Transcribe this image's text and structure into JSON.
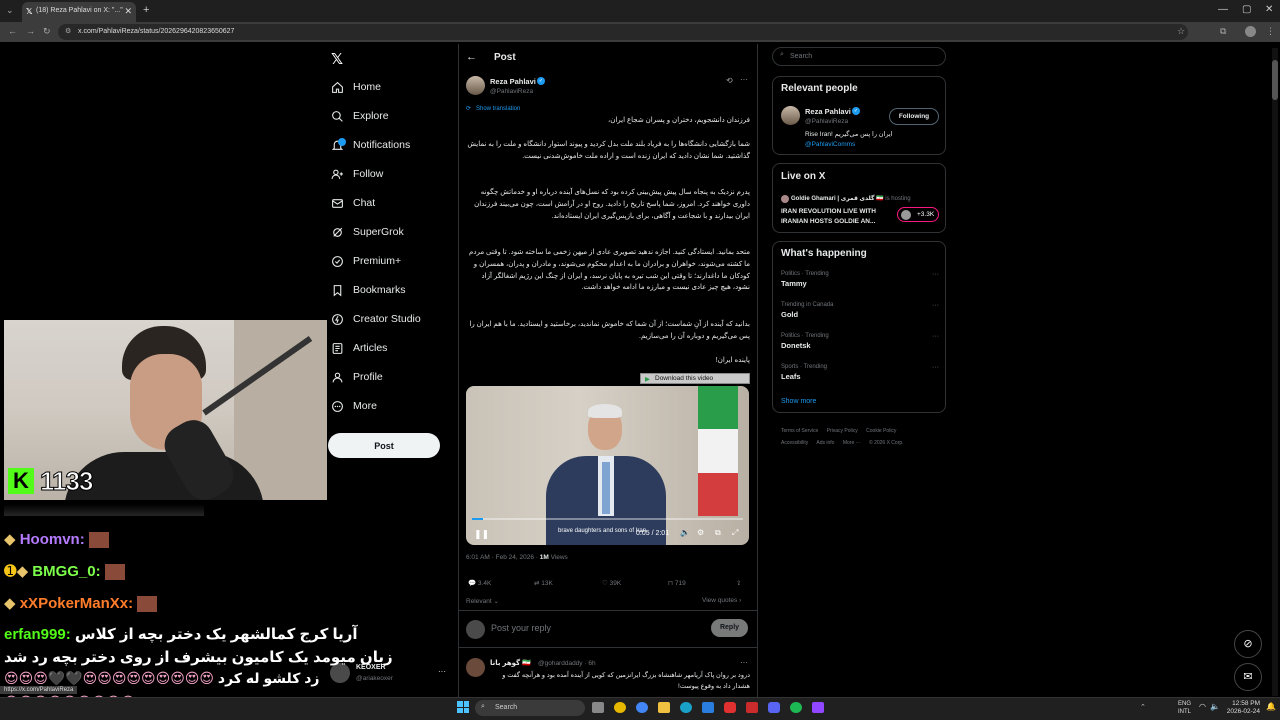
{
  "browser": {
    "tab_title": "(18) Reza Pahlavi on X: \"...\"",
    "url": "x.com/PahlaviReza/status/2026296420823650627",
    "status_url": "https://x.com/PahlaviReza"
  },
  "nav": {
    "items": [
      "Home",
      "Explore",
      "Notifications",
      "Follow",
      "Chat",
      "SuperGrok",
      "Premium+",
      "Bookmarks",
      "Creator Studio",
      "Articles",
      "Profile",
      "More"
    ],
    "post_button": "Post",
    "account_name": "KEOXER",
    "account_handle": "@ariakeoxer"
  },
  "post": {
    "header_title": "Post",
    "author_name": "Reza Pahlavi",
    "author_handle": "@PahlaviReza",
    "show_translation": "Show translation",
    "paragraphs": [
      "فرزندان دانشجویم، دختران و پسران شجاع ایران،",
      "شما بازگشایی دانشگاه‌ها را به فریاد بلند ملت بدل کردید و پیوند استوار دانشگاه و ملت را به نمایش گذاشتید. شما نشان دادید که ایران زنده است و اراده ملت خاموش‌شدنی نیست.",
      "پدرم نزدیک به پنجاه سال پیش پیش‌بینی کرده بود که نسل‌های آینده درباره او و خدماتش چگونه داوری خواهند کرد. امروز، شما پاسخ تاریخ را دادید. روح او در آرامش است، چون می‌بیند فرزندان ایران بیدارند و با شجاعت و آگاهی، برای بازپس‌گیری ایران ایستاده‌اند.",
      "متحد بمانید. ایستادگی کنید. اجازه ندهید تصویری عادی از میهن زخمی ما ساخته شود. تا وقتی مردم ما کشته می‌شوند، خواهران و برادران ما به اعدام محکوم می‌شوند، و مادران و پدران، همسران و کودکان ما داغدارند؛ تا وقتی این شب تیره به پایان نرسد، و ایران از چنگ این رژیم اشغالگر آزاد نشود، هیچ چیز عادی نیست و مبارزه ما ادامه خواهد داشت.",
      "بدانید که آینده از آنِ شماست؛ از آن شما که خاموش نماندید، برخاستید و ایستادید. ما با هم ایران را پس می‌گیریم و دوباره آن را می‌سازیم.",
      "پاینده ایران!"
    ],
    "download_label": "Download this video",
    "video_caption": "brave daughters and sons of Iran",
    "video_time": "0:05 / 2:01",
    "timestamp": "6:01 AM · Feb 24, 2026 ·",
    "views": "1M",
    "views_label": "Views",
    "stats": {
      "replies": "3.4K",
      "reposts": "13K",
      "likes": "39K",
      "bookmarks": "719"
    },
    "relevant": "Relevant",
    "view_quotes": "View quotes",
    "reply_placeholder": "Post your reply",
    "reply_button": "Reply",
    "reply_author": "گوهر بانا 🇮🇷",
    "reply_handle": "@goharddaddy · 6h",
    "reply_text": "درود بر روان پاک آریامهر شاهنشاه بزرگ ایرانزمین که کویی از آینده آمده بود و هرآنچه گفت و هشدار داد به وقوع پیوست!"
  },
  "sidebar": {
    "search_placeholder": "Search",
    "relevant_title": "Relevant people",
    "person_name": "Reza Pahlavi",
    "person_handle": "@PahlaviReza",
    "following_label": "Following",
    "person_bio": "Rise Iran! ایران را پس می‌گیریم",
    "person_link": "@PahlaviComms",
    "live_title": "Live on X",
    "live_host": "Goldie Ghamari | گلدی قمری 🇮🇷",
    "live_hosting": "is hosting",
    "live_event": "IRAN REVOLUTION LIVE WITH IRANIAN HOSTS GOLDIE AN...",
    "live_count": "+3.3K",
    "happening_title": "What's happening",
    "trends": [
      {
        "meta": "Politics · Trending",
        "name": "Tammy"
      },
      {
        "meta": "Trending in Canada",
        "name": "Gold"
      },
      {
        "meta": "Politics · Trending",
        "name": "Donetsk"
      },
      {
        "meta": "Sports · Trending",
        "name": "Leafs"
      }
    ],
    "show_more": "Show more",
    "footer": [
      "Terms of Service",
      "Privacy Policy",
      "Cookie Policy",
      "Accessibility",
      "Ads info",
      "More ···",
      "© 2026 X Corp."
    ]
  },
  "stream": {
    "kick_count": "1133",
    "chat": [
      {
        "user": "Hoomvn:",
        "color": "#b57bff",
        "text": ""
      },
      {
        "user": "BMGG_0:",
        "color": "#7cff4a",
        "text": ""
      },
      {
        "user": "xXPokerManXx:",
        "color": "#ff7d2a",
        "text": ""
      },
      {
        "user": "erfan999:",
        "color": "#53fc18",
        "text": "آریا کرج کمالشهر یک دختر بچه از کلاس"
      },
      {
        "user": "",
        "color": "#fff",
        "text": "زبان میومد یک کامیون بیشرف از روی دختر بچه رد شد"
      },
      {
        "user": "",
        "color": "#fff",
        "text": "زد کلشو له کرد"
      }
    ]
  },
  "taskbar": {
    "search": "Search",
    "lang": "ENG",
    "lang2": "INTL",
    "time": "12:58 PM",
    "date": "2026-02-24"
  }
}
